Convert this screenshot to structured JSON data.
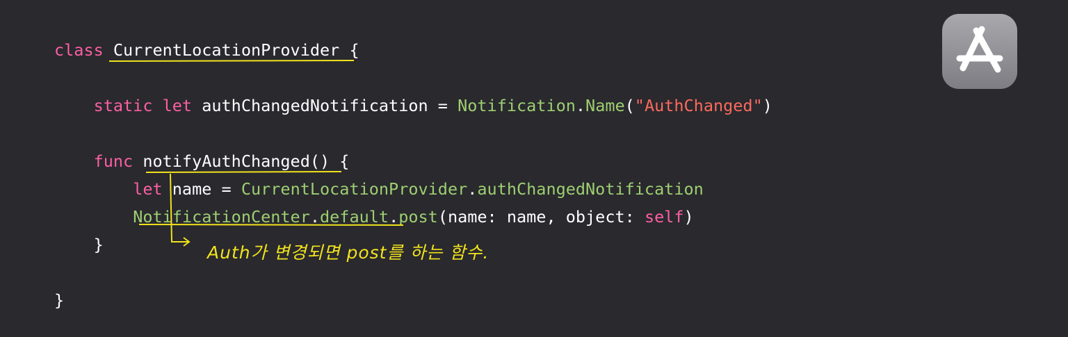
{
  "code": {
    "lines": [
      [
        {
          "t": "class ",
          "c": "kw"
        },
        {
          "t": "CurrentLocationProvider",
          "c": "plain"
        },
        {
          "t": " {",
          "c": "plain"
        }
      ],
      [],
      [
        {
          "t": "    ",
          "c": "plain"
        },
        {
          "t": "static",
          "c": "kw"
        },
        {
          "t": " ",
          "c": "plain"
        },
        {
          "t": "let",
          "c": "kw"
        },
        {
          "t": " authChangedNotification = ",
          "c": "plain"
        },
        {
          "t": "Notification",
          "c": "ty"
        },
        {
          "t": ".",
          "c": "plain"
        },
        {
          "t": "Name",
          "c": "ty"
        },
        {
          "t": "(",
          "c": "plain"
        },
        {
          "t": "\"AuthChanged\"",
          "c": "str"
        },
        {
          "t": ")",
          "c": "plain"
        }
      ],
      [],
      [
        {
          "t": "    ",
          "c": "plain"
        },
        {
          "t": "func",
          "c": "kw"
        },
        {
          "t": " notifyAuthChanged() {",
          "c": "plain"
        }
      ],
      [
        {
          "t": "        ",
          "c": "plain"
        },
        {
          "t": "let",
          "c": "kw"
        },
        {
          "t": " name = ",
          "c": "plain"
        },
        {
          "t": "CurrentLocationProvider",
          "c": "ty"
        },
        {
          "t": ".",
          "c": "plain"
        },
        {
          "t": "authChangedNotification",
          "c": "ty"
        }
      ],
      [
        {
          "t": "        ",
          "c": "plain"
        },
        {
          "t": "NotificationCenter",
          "c": "ty"
        },
        {
          "t": ".",
          "c": "plain"
        },
        {
          "t": "default",
          "c": "ty"
        },
        {
          "t": ".",
          "c": "plain"
        },
        {
          "t": "post",
          "c": "ty"
        },
        {
          "t": "(name: name, object: ",
          "c": "plain"
        },
        {
          "t": "self",
          "c": "kw"
        },
        {
          "t": ")",
          "c": "plain"
        }
      ],
      [
        {
          "t": "    }",
          "c": "plain"
        }
      ],
      [],
      [
        {
          "t": "}",
          "c": "plain"
        }
      ]
    ]
  },
  "annotation": {
    "note": "Auth가 변경되면  post를  하는  함수."
  },
  "colors": {
    "background": "#29292e",
    "keyword": "#fc5fa3",
    "type": "#9ecf71",
    "string": "#fc6a5d",
    "annotation": "#f2e31c"
  },
  "icons": {
    "app_icon": "app-store-icon"
  }
}
